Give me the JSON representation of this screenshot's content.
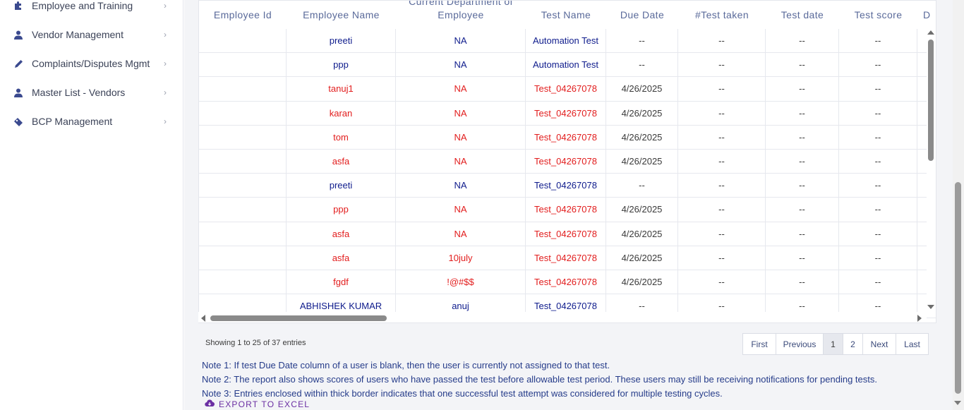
{
  "sidebar": {
    "items": [
      {
        "label": "Employee and Training",
        "icon": "puzzle-icon"
      },
      {
        "label": "Vendor Management",
        "icon": "user-icon"
      },
      {
        "label": "Complaints/Disputes Mgmt",
        "icon": "pencil-icon"
      },
      {
        "label": "Master List - Vendors",
        "icon": "user-icon"
      },
      {
        "label": "BCP Management",
        "icon": "ticket-icon"
      }
    ],
    "chevron": "›"
  },
  "table": {
    "headers": [
      "Employee Id",
      "Employee Name",
      "Current Department of Employee",
      "Test Name",
      "Due Date",
      "#Test taken",
      "Test date",
      "Test score",
      "D"
    ],
    "rows": [
      {
        "id": "",
        "name": "preeti",
        "dept": "NA",
        "test": "Automation Test",
        "due": "--",
        "taken": "--",
        "date": "--",
        "score": "--",
        "color": "blue"
      },
      {
        "id": "",
        "name": "ppp",
        "dept": "NA",
        "test": "Automation Test",
        "due": "--",
        "taken": "--",
        "date": "--",
        "score": "--",
        "color": "blue"
      },
      {
        "id": "",
        "name": "tanuj1",
        "dept": "NA",
        "test": "Test_04267078",
        "due": "4/26/2025",
        "taken": "--",
        "date": "--",
        "score": "--",
        "color": "red"
      },
      {
        "id": "",
        "name": "karan",
        "dept": "NA",
        "test": "Test_04267078",
        "due": "4/26/2025",
        "taken": "--",
        "date": "--",
        "score": "--",
        "color": "red"
      },
      {
        "id": "",
        "name": "tom",
        "dept": "NA",
        "test": "Test_04267078",
        "due": "4/26/2025",
        "taken": "--",
        "date": "--",
        "score": "--",
        "color": "red"
      },
      {
        "id": "",
        "name": "asfa",
        "dept": "NA",
        "test": "Test_04267078",
        "due": "4/26/2025",
        "taken": "--",
        "date": "--",
        "score": "--",
        "color": "red"
      },
      {
        "id": "",
        "name": "preeti",
        "dept": "NA",
        "test": "Test_04267078",
        "due": "--",
        "taken": "--",
        "date": "--",
        "score": "--",
        "color": "blue"
      },
      {
        "id": "",
        "name": "ppp",
        "dept": "NA",
        "test": "Test_04267078",
        "due": "4/26/2025",
        "taken": "--",
        "date": "--",
        "score": "--",
        "color": "red"
      },
      {
        "id": "",
        "name": "asfa",
        "dept": "NA",
        "test": "Test_04267078",
        "due": "4/26/2025",
        "taken": "--",
        "date": "--",
        "score": "--",
        "color": "red"
      },
      {
        "id": "",
        "name": "asfa",
        "dept": "10july",
        "test": "Test_04267078",
        "due": "4/26/2025",
        "taken": "--",
        "date": "--",
        "score": "--",
        "color": "red"
      },
      {
        "id": "",
        "name": "fgdf",
        "dept": "!@#$$",
        "test": "Test_04267078",
        "due": "4/26/2025",
        "taken": "--",
        "date": "--",
        "score": "--",
        "color": "red"
      },
      {
        "id": "",
        "name": "ABHISHEK KUMAR",
        "dept": "anuj",
        "test": "Test_04267078",
        "due": "--",
        "taken": "--",
        "date": "--",
        "score": "--",
        "color": "blue"
      }
    ]
  },
  "footer": {
    "showing": "Showing 1 to 25 of 37 entries",
    "pager": [
      "First",
      "Previous",
      "1",
      "2",
      "Next",
      "Last"
    ],
    "active_page": "1",
    "notes": [
      "Note 1: If test Due Date column of a user is blank, then the user is currently not assigned to that test.",
      "Note 2: The report also shows scores of users who have passed the test before allowable test period. These users may still be receiving notifications for pending tests.",
      "Note 3: Entries enclosed within thick border indicates that one successful test attempt was considered for multiple testing cycles."
    ],
    "export_label": "EXPORT TO EXCEL"
  },
  "colors": {
    "blue_text": "#0e1b8c",
    "red_text": "#e21d1d",
    "note_text": "#263c8a",
    "export": "#6b2fa3"
  }
}
